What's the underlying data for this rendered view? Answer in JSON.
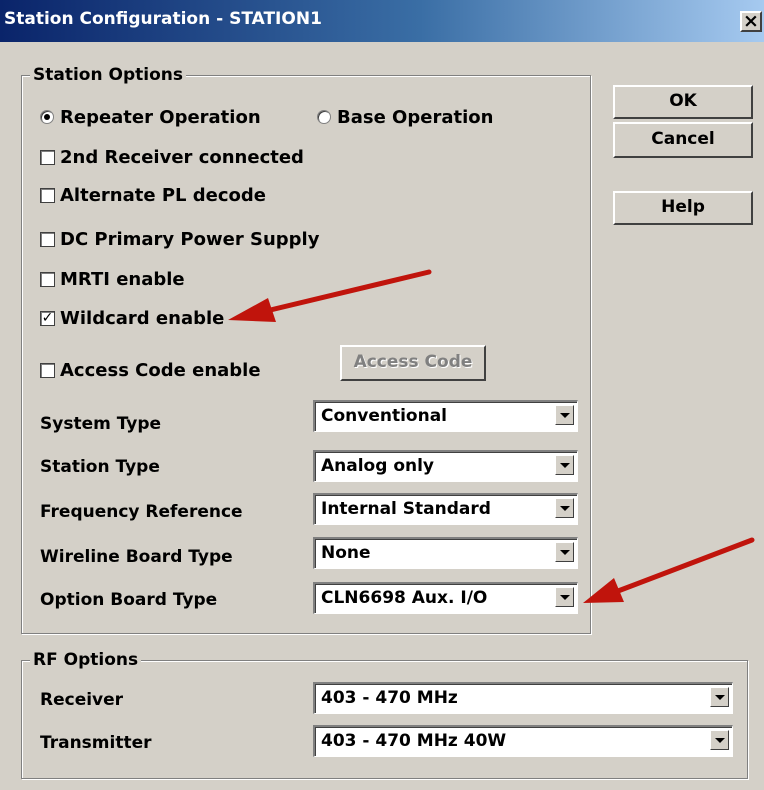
{
  "window": {
    "title": "Station Configuration - STATION1",
    "close_glyph": "×"
  },
  "station_options": {
    "legend": "Station Options",
    "radios": {
      "repeater_label": "Repeater Operation",
      "repeater_selected": true,
      "base_label": "Base Operation",
      "base_selected": false
    },
    "checkboxes": {
      "second_receiver": {
        "label": "2nd Receiver connected",
        "checked": false
      },
      "alternate_pl": {
        "label": "Alternate PL decode",
        "checked": false
      },
      "dc_power": {
        "label": "DC Primary Power Supply",
        "checked": false
      },
      "mrti": {
        "label": "MRTI enable",
        "checked": false
      },
      "wildcard": {
        "label": "Wildcard enable",
        "checked": true,
        "mark": "✓"
      },
      "access_code": {
        "label": "Access Code enable",
        "checked": false
      }
    },
    "access_code_button": {
      "label": "Access Code",
      "enabled": false
    },
    "fields": {
      "system_type": {
        "label": "System Type",
        "value": "Conventional"
      },
      "station_type": {
        "label": "Station Type",
        "value": "Analog only"
      },
      "frequency_reference": {
        "label": "Frequency Reference",
        "value": "Internal Standard"
      },
      "wireline_board_type": {
        "label": "Wireline Board Type",
        "value": "None"
      },
      "option_board_type": {
        "label": "Option Board Type",
        "value": "CLN6698  Aux. I/O"
      }
    }
  },
  "buttons": {
    "ok": "OK",
    "cancel": "Cancel",
    "help": "Help"
  },
  "rf_options": {
    "legend": "RF Options",
    "receiver": {
      "label": "Receiver",
      "value": "403 - 470 MHz"
    },
    "transmitter": {
      "label": "Transmitter",
      "value": "403 - 470 MHz  40W"
    }
  },
  "annotation": {
    "arrow_color": "#c0140c",
    "arrows": [
      "points to Wildcard enable",
      "points to Option Board Type dropdown"
    ]
  },
  "colors": {
    "face": "#d4d0c8",
    "title_start": "#0a246a",
    "title_end": "#a6caf0"
  }
}
